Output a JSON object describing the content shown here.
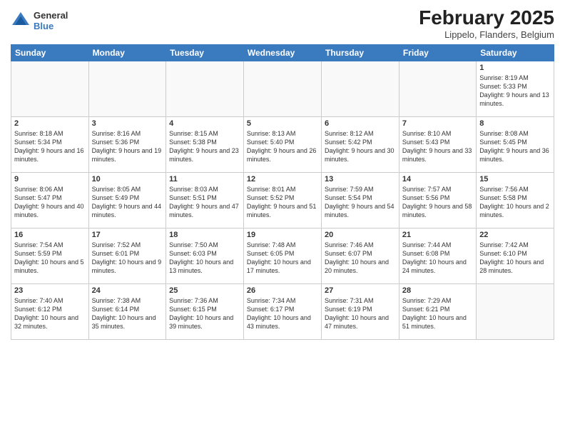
{
  "header": {
    "logo_general": "General",
    "logo_blue": "Blue",
    "month_title": "February 2025",
    "location": "Lippelo, Flanders, Belgium"
  },
  "columns": [
    "Sunday",
    "Monday",
    "Tuesday",
    "Wednesday",
    "Thursday",
    "Friday",
    "Saturday"
  ],
  "weeks": [
    [
      {
        "day": "",
        "info": ""
      },
      {
        "day": "",
        "info": ""
      },
      {
        "day": "",
        "info": ""
      },
      {
        "day": "",
        "info": ""
      },
      {
        "day": "",
        "info": ""
      },
      {
        "day": "",
        "info": ""
      },
      {
        "day": "1",
        "info": "Sunrise: 8:19 AM\nSunset: 5:33 PM\nDaylight: 9 hours and 13 minutes."
      }
    ],
    [
      {
        "day": "2",
        "info": "Sunrise: 8:18 AM\nSunset: 5:34 PM\nDaylight: 9 hours and 16 minutes."
      },
      {
        "day": "3",
        "info": "Sunrise: 8:16 AM\nSunset: 5:36 PM\nDaylight: 9 hours and 19 minutes."
      },
      {
        "day": "4",
        "info": "Sunrise: 8:15 AM\nSunset: 5:38 PM\nDaylight: 9 hours and 23 minutes."
      },
      {
        "day": "5",
        "info": "Sunrise: 8:13 AM\nSunset: 5:40 PM\nDaylight: 9 hours and 26 minutes."
      },
      {
        "day": "6",
        "info": "Sunrise: 8:12 AM\nSunset: 5:42 PM\nDaylight: 9 hours and 30 minutes."
      },
      {
        "day": "7",
        "info": "Sunrise: 8:10 AM\nSunset: 5:43 PM\nDaylight: 9 hours and 33 minutes."
      },
      {
        "day": "8",
        "info": "Sunrise: 8:08 AM\nSunset: 5:45 PM\nDaylight: 9 hours and 36 minutes."
      }
    ],
    [
      {
        "day": "9",
        "info": "Sunrise: 8:06 AM\nSunset: 5:47 PM\nDaylight: 9 hours and 40 minutes."
      },
      {
        "day": "10",
        "info": "Sunrise: 8:05 AM\nSunset: 5:49 PM\nDaylight: 9 hours and 44 minutes."
      },
      {
        "day": "11",
        "info": "Sunrise: 8:03 AM\nSunset: 5:51 PM\nDaylight: 9 hours and 47 minutes."
      },
      {
        "day": "12",
        "info": "Sunrise: 8:01 AM\nSunset: 5:52 PM\nDaylight: 9 hours and 51 minutes."
      },
      {
        "day": "13",
        "info": "Sunrise: 7:59 AM\nSunset: 5:54 PM\nDaylight: 9 hours and 54 minutes."
      },
      {
        "day": "14",
        "info": "Sunrise: 7:57 AM\nSunset: 5:56 PM\nDaylight: 9 hours and 58 minutes."
      },
      {
        "day": "15",
        "info": "Sunrise: 7:56 AM\nSunset: 5:58 PM\nDaylight: 10 hours and 2 minutes."
      }
    ],
    [
      {
        "day": "16",
        "info": "Sunrise: 7:54 AM\nSunset: 5:59 PM\nDaylight: 10 hours and 5 minutes."
      },
      {
        "day": "17",
        "info": "Sunrise: 7:52 AM\nSunset: 6:01 PM\nDaylight: 10 hours and 9 minutes."
      },
      {
        "day": "18",
        "info": "Sunrise: 7:50 AM\nSunset: 6:03 PM\nDaylight: 10 hours and 13 minutes."
      },
      {
        "day": "19",
        "info": "Sunrise: 7:48 AM\nSunset: 6:05 PM\nDaylight: 10 hours and 17 minutes."
      },
      {
        "day": "20",
        "info": "Sunrise: 7:46 AM\nSunset: 6:07 PM\nDaylight: 10 hours and 20 minutes."
      },
      {
        "day": "21",
        "info": "Sunrise: 7:44 AM\nSunset: 6:08 PM\nDaylight: 10 hours and 24 minutes."
      },
      {
        "day": "22",
        "info": "Sunrise: 7:42 AM\nSunset: 6:10 PM\nDaylight: 10 hours and 28 minutes."
      }
    ],
    [
      {
        "day": "23",
        "info": "Sunrise: 7:40 AM\nSunset: 6:12 PM\nDaylight: 10 hours and 32 minutes."
      },
      {
        "day": "24",
        "info": "Sunrise: 7:38 AM\nSunset: 6:14 PM\nDaylight: 10 hours and 35 minutes."
      },
      {
        "day": "25",
        "info": "Sunrise: 7:36 AM\nSunset: 6:15 PM\nDaylight: 10 hours and 39 minutes."
      },
      {
        "day": "26",
        "info": "Sunrise: 7:34 AM\nSunset: 6:17 PM\nDaylight: 10 hours and 43 minutes."
      },
      {
        "day": "27",
        "info": "Sunrise: 7:31 AM\nSunset: 6:19 PM\nDaylight: 10 hours and 47 minutes."
      },
      {
        "day": "28",
        "info": "Sunrise: 7:29 AM\nSunset: 6:21 PM\nDaylight: 10 hours and 51 minutes."
      },
      {
        "day": "",
        "info": ""
      }
    ]
  ]
}
